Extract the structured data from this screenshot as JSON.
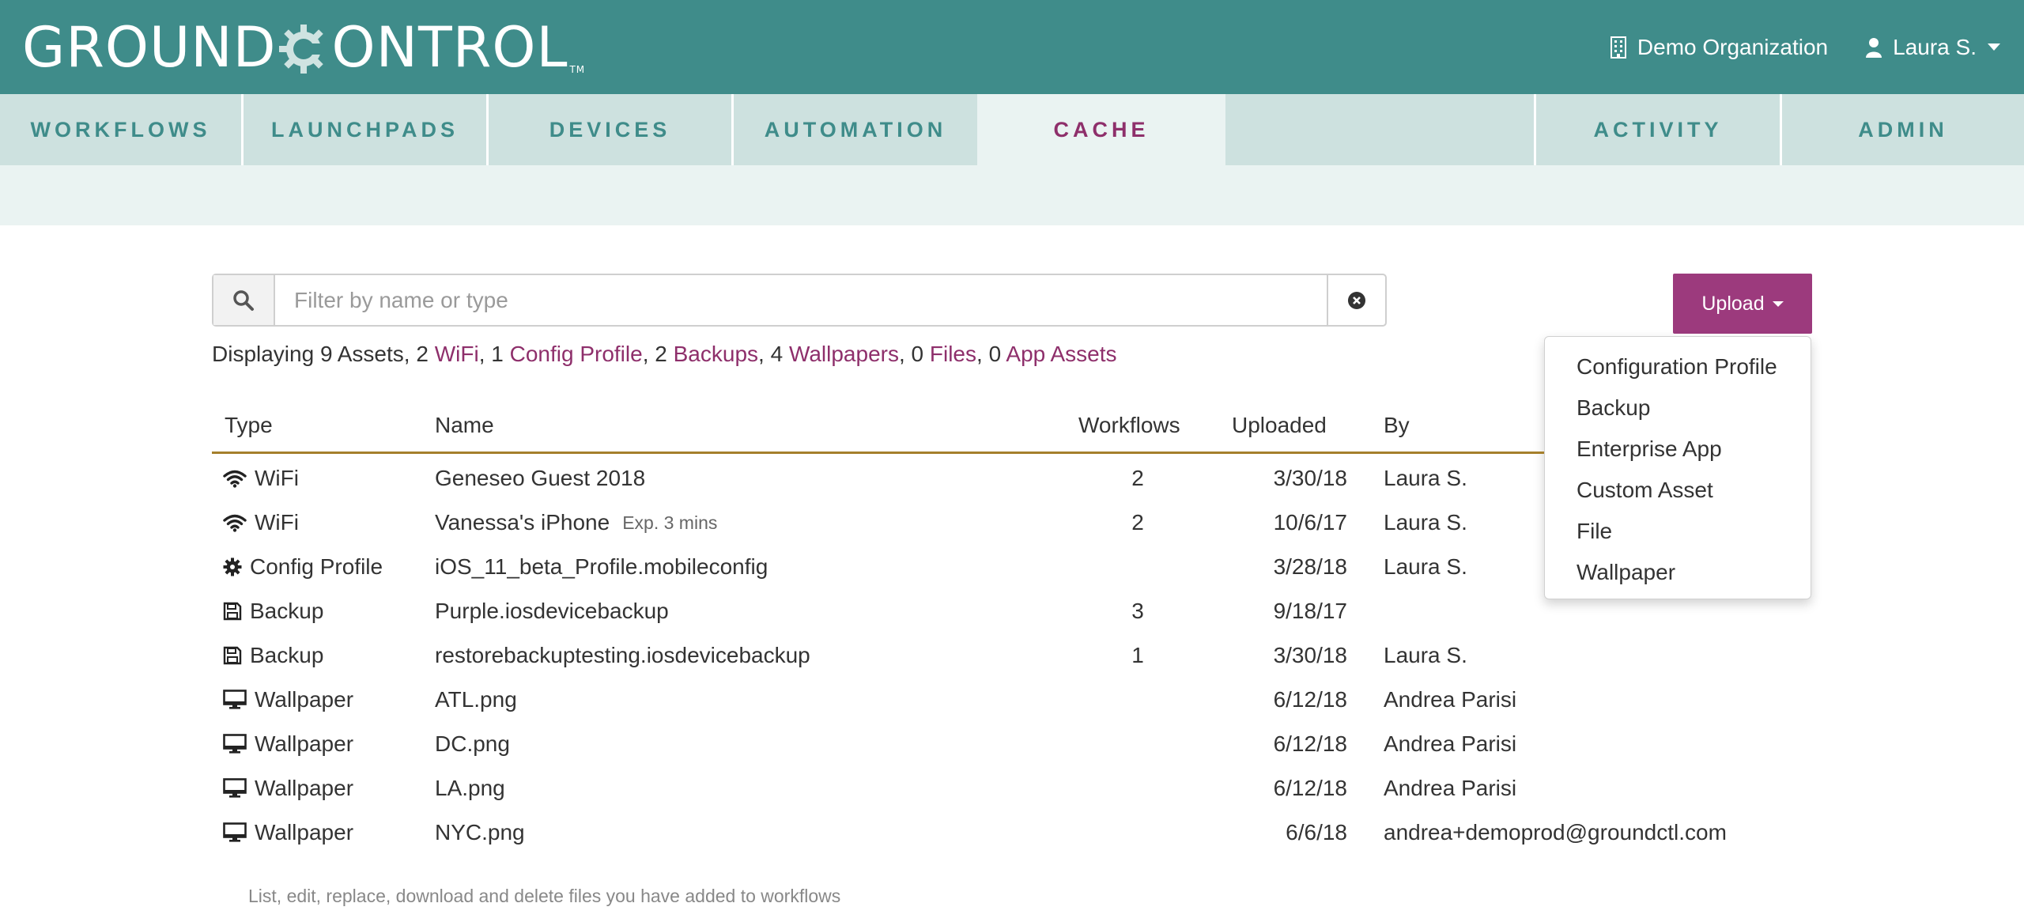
{
  "header": {
    "logo_left": "GROUND",
    "logo_right": "ONTROL",
    "logo_tm": "TM",
    "org": "Demo Organization",
    "user": "Laura S."
  },
  "colors": {
    "header_bg": "#3f8c8a",
    "nav_bg": "#cde1df",
    "active_tab_bg": "#eaf3f2",
    "accent": "#9c3a7d",
    "link": "#8e2f6b",
    "table_rule": "#a57f2b"
  },
  "nav": {
    "tabs": [
      {
        "label": "WORKFLOWS"
      },
      {
        "label": "LAUNCHPADS"
      },
      {
        "label": "DEVICES"
      },
      {
        "label": "AUTOMATION"
      },
      {
        "label": "CACHE"
      },
      {
        "label": "ACTIVITY"
      },
      {
        "label": "ADMIN"
      }
    ],
    "active": "CACHE"
  },
  "search": {
    "placeholder": "Filter by name or type",
    "value": ""
  },
  "upload": {
    "label": "Upload",
    "options": [
      "Configuration Profile",
      "Backup",
      "Enterprise App",
      "Custom Asset",
      "File",
      "Wallpaper"
    ]
  },
  "summary": {
    "prefix": "Displaying 9 Assets, ",
    "items": [
      {
        "count": "2",
        "label": "WiFi",
        "sep": ", "
      },
      {
        "count": "1",
        "label": "Config Profile",
        "sep": ", "
      },
      {
        "count": "2",
        "label": "Backups",
        "sep": ", "
      },
      {
        "count": "4",
        "label": "Wallpapers",
        "sep": ", "
      },
      {
        "count": "0",
        "label": "Files",
        "sep": ", "
      },
      {
        "count": "0",
        "label": "App Assets",
        "sep": ""
      }
    ]
  },
  "table": {
    "columns": [
      "Type",
      "Name",
      "Workflows",
      "Uploaded",
      "By"
    ],
    "rows": [
      {
        "icon": "wifi-icon",
        "type": "WiFi",
        "name": "Geneseo Guest 2018",
        "exp": "",
        "workflows": "2",
        "uploaded": "3/30/18",
        "by": "Laura S."
      },
      {
        "icon": "wifi-icon",
        "type": "WiFi",
        "name": "Vanessa's iPhone",
        "exp": "Exp. 3 mins",
        "workflows": "2",
        "uploaded": "10/6/17",
        "by": "Laura S."
      },
      {
        "icon": "gear-icon",
        "type": "Config Profile",
        "name": "iOS_11_beta_Profile.mobileconfig",
        "exp": "",
        "workflows": "",
        "uploaded": "3/28/18",
        "by": "Laura S."
      },
      {
        "icon": "floppy-icon",
        "type": "Backup",
        "name": "Purple.iosdevicebackup",
        "exp": "",
        "workflows": "3",
        "uploaded": "9/18/17",
        "by": ""
      },
      {
        "icon": "floppy-icon",
        "type": "Backup",
        "name": "restorebackuptesting.iosdevicebackup",
        "exp": "",
        "workflows": "1",
        "uploaded": "3/30/18",
        "by": "Laura S."
      },
      {
        "icon": "monitor-icon",
        "type": "Wallpaper",
        "name": "ATL.png",
        "exp": "",
        "workflows": "",
        "uploaded": "6/12/18",
        "by": "Andrea Parisi"
      },
      {
        "icon": "monitor-icon",
        "type": "Wallpaper",
        "name": "DC.png",
        "exp": "",
        "workflows": "",
        "uploaded": "6/12/18",
        "by": "Andrea Parisi"
      },
      {
        "icon": "monitor-icon",
        "type": "Wallpaper",
        "name": "LA.png",
        "exp": "",
        "workflows": "",
        "uploaded": "6/12/18",
        "by": "Andrea Parisi"
      },
      {
        "icon": "monitor-icon",
        "type": "Wallpaper",
        "name": "NYC.png",
        "exp": "",
        "workflows": "",
        "uploaded": "6/6/18",
        "by": "andrea+demoprod@groundctl.com"
      }
    ]
  },
  "footnote": "List, edit, replace, download and delete files you have added to workflows"
}
